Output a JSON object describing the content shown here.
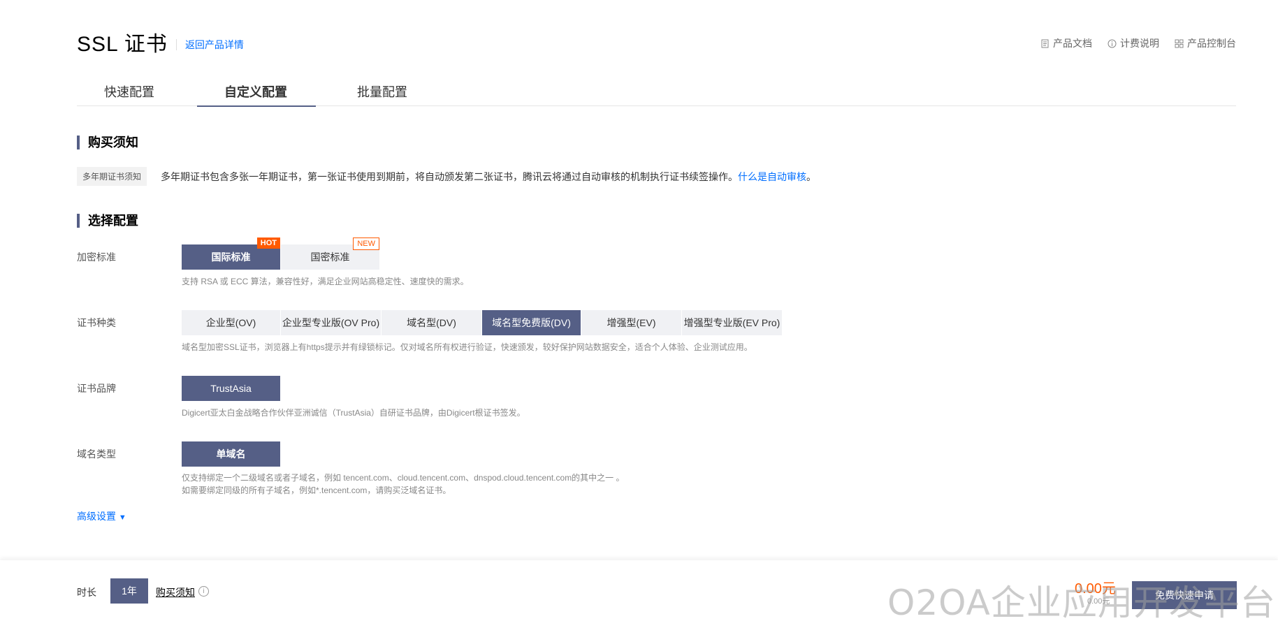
{
  "header": {
    "title": "SSL 证书",
    "back_link": "返回产品详情",
    "links": [
      {
        "label": "产品文档",
        "icon": "document-icon"
      },
      {
        "label": "计费说明",
        "icon": "info-icon"
      },
      {
        "label": "产品控制台",
        "icon": "grid-icon"
      }
    ]
  },
  "tabs": [
    {
      "label": "快速配置",
      "active": false
    },
    {
      "label": "自定义配置",
      "active": true
    },
    {
      "label": "批量配置",
      "active": false
    }
  ],
  "notice_section": {
    "title": "购买须知",
    "tag": "多年期证书须知",
    "text": "多年期证书包含多张一年期证书，第一张证书使用到期前，将自动颁发第二张证书，腾讯云将通过自动审核的机制执行证书续签操作。",
    "link": "什么是自动审核",
    "suffix": "。"
  },
  "config_section": {
    "title": "选择配置",
    "encryption": {
      "label": "加密标准",
      "options": [
        {
          "label": "国际标准",
          "badge": "HOT",
          "selected": true
        },
        {
          "label": "国密标准",
          "badge": "NEW",
          "selected": false
        }
      ],
      "hint": "支持 RSA 或 ECC 算法，兼容性好，满足企业网站高稳定性、速度快的需求。"
    },
    "cert_type": {
      "label": "证书种类",
      "options": [
        {
          "label": "企业型(OV)",
          "selected": false
        },
        {
          "label": "企业型专业版(OV Pro)",
          "selected": false
        },
        {
          "label": "域名型(DV)",
          "selected": false
        },
        {
          "label": "域名型免费版(DV)",
          "selected": true
        },
        {
          "label": "增强型(EV)",
          "selected": false
        },
        {
          "label": "增强型专业版(EV Pro)",
          "selected": false
        }
      ],
      "hint": "域名型加密SSL证书，浏览器上有https提示并有绿锁标记。仅对域名所有权进行验证，快速颁发，较好保护网站数据安全，适合个人体验、企业测试应用。"
    },
    "brand": {
      "label": "证书品牌",
      "options": [
        {
          "label": "TrustAsia",
          "selected": true
        }
      ],
      "hint": "Digicert亚太白金战略合作伙伴亚洲诚信（TrustAsia）自研证书品牌，由Digicert根证书签发。"
    },
    "domain_type": {
      "label": "域名类型",
      "options": [
        {
          "label": "单域名",
          "selected": true
        }
      ],
      "hint_line1": "仅支持绑定一个二级域名或者子域名，例如 tencent.com、cloud.tencent.com、dnspod.cloud.tencent.com的其中之一 。",
      "hint_line2": "如需要绑定同级的所有子域名，例如*.tencent.com，请购买泛域名证书。"
    },
    "advanced": "高级设置"
  },
  "footer": {
    "duration_label": "时长",
    "duration_value": "1年",
    "buy_notice": "购买须知",
    "price": "0.00元",
    "price_sub": "0.00元",
    "apply_button": "免费快速申请"
  },
  "watermark": "O2OA企业应用开发平台",
  "colors": {
    "primary": "#555f86",
    "link": "#006eff",
    "hot": "#ff5a00"
  }
}
